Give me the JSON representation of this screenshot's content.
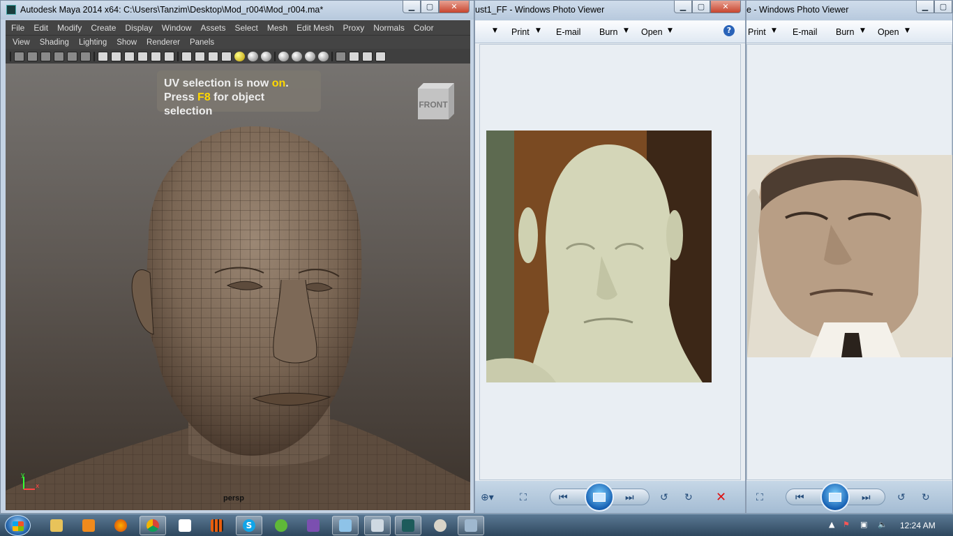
{
  "maya": {
    "title": "Autodesk Maya 2014 x64: C:\\Users\\Tanzim\\Desktop\\Mod_r004\\Mod_r004.ma*",
    "menus": [
      "File",
      "Edit",
      "Modify",
      "Create",
      "Display",
      "Window",
      "Assets",
      "Select",
      "Mesh",
      "Edit Mesh",
      "Proxy",
      "Normals",
      "Color"
    ],
    "panel_menus": [
      "View",
      "Shading",
      "Lighting",
      "Show",
      "Renderer",
      "Panels"
    ],
    "uv_message": {
      "line1_pre": "UV selection is now ",
      "line1_hl": "on",
      "line1_post": ".",
      "line2_pre": "Press ",
      "line2_hl": "F8",
      "line2_post": " for object selection"
    },
    "viewcube_label": "FRONT",
    "camera_label": "persp",
    "axis_y": "y",
    "axis_x": "x"
  },
  "viewer1": {
    "title": "ust1_FF - Windows Photo Viewer",
    "menu": {
      "print": "Print",
      "email": "E-mail",
      "burn": "Burn",
      "open": "Open"
    },
    "help_icon": "?"
  },
  "viewer2": {
    "title": "e - Windows Photo Viewer",
    "menu": {
      "print": "Print",
      "email": "E-mail",
      "burn": "Burn",
      "open": "Open"
    }
  },
  "taskbar": {
    "clock": "12:24 AM",
    "apps": [
      "explorer",
      "media-player",
      "firefox",
      "chrome",
      "notepad",
      "bethesda",
      "skype",
      "utorrent",
      "visual-studio",
      "photo-viewer",
      "calculator",
      "maya",
      "paint",
      "remote"
    ]
  },
  "colors": {
    "maya_viewport_top": "#767370",
    "maya_viewport_bottom": "#3b322b",
    "accent_yellow": "#ffd800"
  }
}
